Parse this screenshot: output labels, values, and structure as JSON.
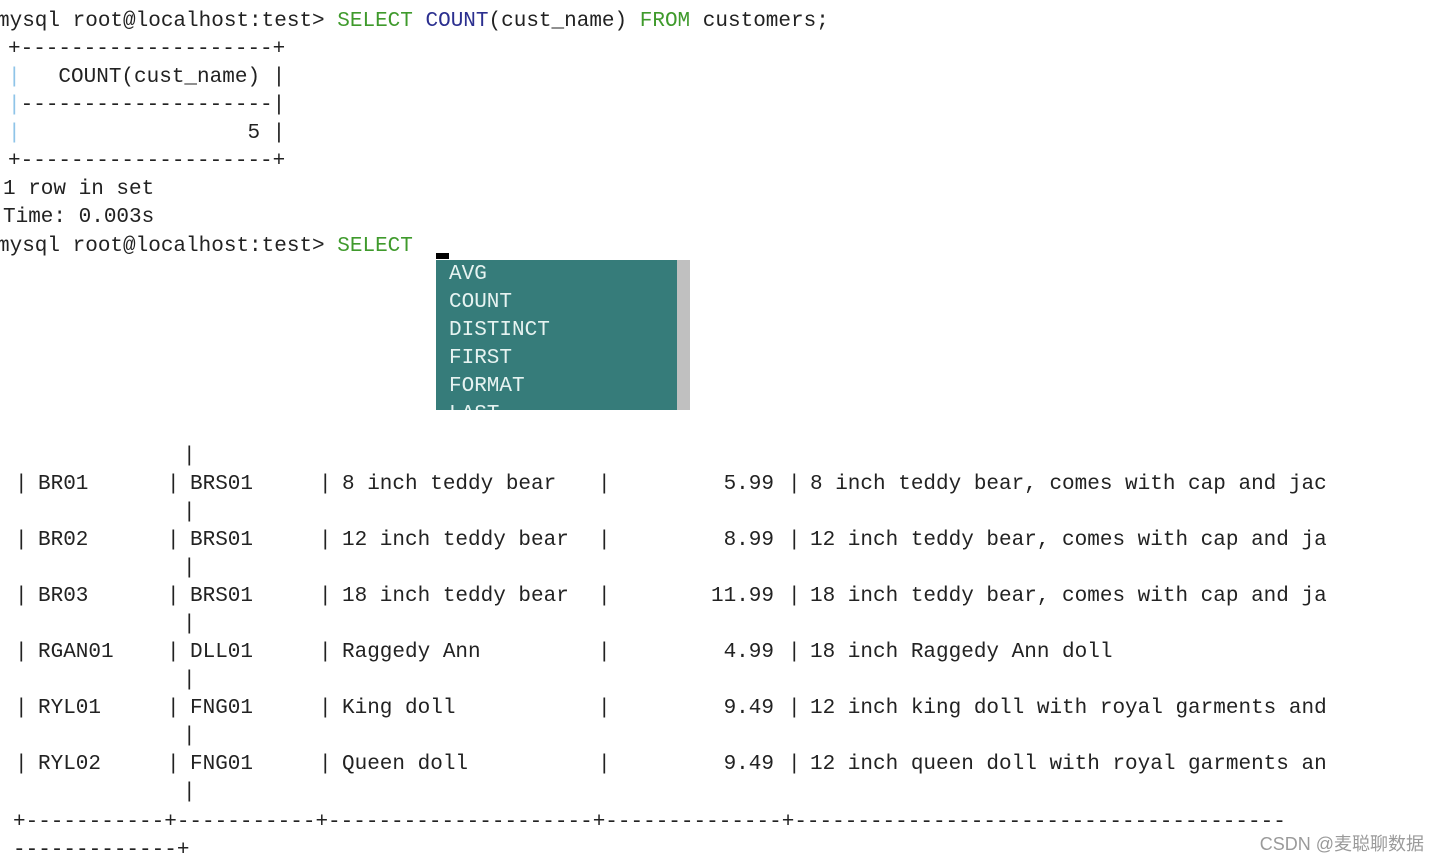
{
  "prompt": "mysql root@localhost:test> ",
  "query1": {
    "select": "SELECT",
    "func": "COUNT",
    "args": "(cust_name)",
    "from": "FROM",
    "rest": "customers;"
  },
  "result1": {
    "border": "+--------------------+",
    "header": "   COUNT(cust_name) ",
    "sep": "--------------------",
    "value": "                  5 ",
    "pipe": "|",
    "rows_text": "1 row in set",
    "time_text": "Time: 0.003s"
  },
  "query2": {
    "select": "SELECT"
  },
  "autocomplete": {
    "items": [
      "AVG",
      "COUNT",
      "DISTINCT",
      "FIRST",
      "FORMAT",
      "LAST"
    ],
    "bg": "#367c7a"
  },
  "result2": {
    "rows": [
      {
        "id": "BR01",
        "vend": "BRS01",
        "name": "8 inch teddy bear",
        "price": "5.99",
        "desc": "8 inch teddy bear, comes with cap and jac"
      },
      {
        "id": "BR02",
        "vend": "BRS01",
        "name": "12 inch teddy bear",
        "price": "8.99",
        "desc": "12 inch teddy bear, comes with cap and ja"
      },
      {
        "id": "BR03",
        "vend": "BRS01",
        "name": "18 inch teddy bear",
        "price": "11.99",
        "desc": "18 inch teddy bear, comes with cap and ja"
      },
      {
        "id": "RGAN01",
        "vend": "DLL01",
        "name": "Raggedy Ann",
        "price": "4.99",
        "desc": "18 inch Raggedy Ann doll"
      },
      {
        "id": "RYL01",
        "vend": "FNG01",
        "name": "King doll",
        "price": "9.49",
        "desc": "12 inch king doll with royal garments and"
      },
      {
        "id": "RYL02",
        "vend": "FNG01",
        "name": "Queen doll",
        "price": "9.49",
        "desc": "12 inch queen doll with royal garments an"
      }
    ],
    "pipe": "|",
    "border": "+-----------+-----------+---------------------+--------------+---------------------------------------",
    "border_tail": "-------------+"
  },
  "watermark": "CSDN @麦聪聊数据"
}
